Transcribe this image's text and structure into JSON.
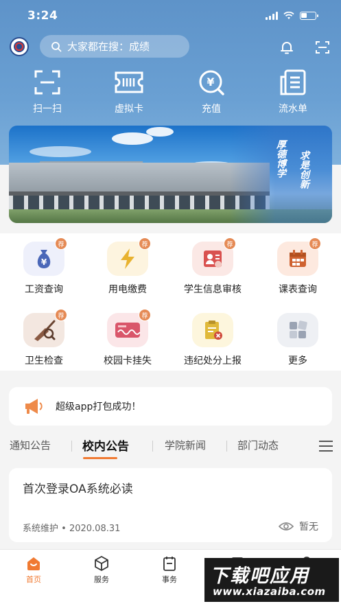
{
  "status_bar": {
    "time": "3:24"
  },
  "search": {
    "placeholder": "大家都在搜：成绩"
  },
  "quick_actions": [
    {
      "label": "扫一扫",
      "icon": "scan-icon"
    },
    {
      "label": "虚拟卡",
      "icon": "virtual-card-icon"
    },
    {
      "label": "充值",
      "icon": "recharge-icon"
    },
    {
      "label": "流水单",
      "icon": "statement-icon"
    }
  ],
  "banner": {
    "motto_right": "求是创新",
    "motto_left": "厚德博学"
  },
  "services": [
    {
      "label": "工资查询",
      "icon": "money-bag-icon",
      "badge": "荐",
      "color": "#eef0fb"
    },
    {
      "label": "用电缴费",
      "icon": "lightning-icon",
      "badge": "荐",
      "color": "#fdf4df"
    },
    {
      "label": "学生信息审核",
      "icon": "student-info-icon",
      "badge": "荐",
      "color": "#fbe8e5"
    },
    {
      "label": "课表查询",
      "icon": "calendar-icon",
      "badge": "荐",
      "color": "#fde9df"
    },
    {
      "label": "卫生检查",
      "icon": "broom-icon",
      "badge": "荐",
      "color": "#f3e7e0"
    },
    {
      "label": "校园卡挂失",
      "icon": "card-lost-icon",
      "badge": "荐",
      "color": "#fbe6e8"
    },
    {
      "label": "违纪处分上报",
      "icon": "report-icon",
      "badge": "",
      "color": "#fdf6dd"
    },
    {
      "label": "更多",
      "icon": "more-grid-icon",
      "badge": "",
      "color": "#eef0f4"
    }
  ],
  "announcement": {
    "text": "超级app打包成功！"
  },
  "news_tabs": [
    {
      "label": "通知公告",
      "active": false
    },
    {
      "label": "校内公告",
      "active": true
    },
    {
      "label": "学院新闻",
      "active": false
    },
    {
      "label": "部门动态",
      "active": false
    }
  ],
  "article": {
    "title": "首次登录OA系统必读",
    "author": "系统维护",
    "separator": "•",
    "date": "2020.08.31",
    "views": "暂无"
  },
  "tabbar": [
    {
      "label": "首页",
      "active": true
    },
    {
      "label": "服务",
      "active": false
    },
    {
      "label": "事务",
      "active": false
    },
    {
      "label": "",
      "active": false
    },
    {
      "label": "",
      "active": false
    }
  ],
  "watermark": {
    "line1": "下载吧应用",
    "line2": "www.xiazaiba.com"
  },
  "colors": {
    "header": "#5e93c9",
    "accent": "#f07a32",
    "badge": "#e58a55"
  }
}
